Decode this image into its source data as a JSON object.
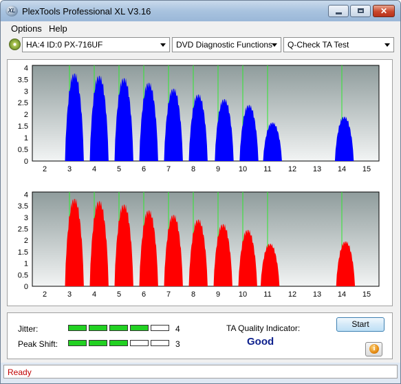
{
  "window": {
    "title": "PlexTools Professional XL V3.16",
    "icon_text": "XL"
  },
  "menu": {
    "options": "Options",
    "help": "Help"
  },
  "toolbar": {
    "drive": "HA:4 ID:0  PX-716UF",
    "function": "DVD Diagnostic Functions",
    "test": "Q-Check TA Test"
  },
  "colors": {
    "top_series": "#0000ff",
    "bottom_series": "#ff0000",
    "gridline": "#2ee82e",
    "plot_bg": "#9ea9a9"
  },
  "chart_data": [
    {
      "type": "area",
      "x_ticks": [
        "2",
        "3",
        "4",
        "5",
        "6",
        "7",
        "8",
        "9",
        "10",
        "11",
        "12",
        "13",
        "14",
        "15"
      ],
      "y_ticks": [
        "0",
        "0.5",
        "1",
        "1.5",
        "2",
        "2.5",
        "3",
        "3.5",
        "4"
      ],
      "xlim": [
        1.5,
        15.5
      ],
      "ylim": [
        0,
        4.1
      ],
      "grid": "vertical lines at 3, 4, 5, 6, 7, 8, 9, 10, 11, 14",
      "series": [
        {
          "peaks": [
            {
              "center": 3.2,
              "height": 3.75
            },
            {
              "center": 4.2,
              "height": 3.65
            },
            {
              "center": 5.2,
              "height": 3.55
            },
            {
              "center": 6.2,
              "height": 3.35
            },
            {
              "center": 7.2,
              "height": 3.1
            },
            {
              "center": 8.2,
              "height": 2.85
            },
            {
              "center": 9.25,
              "height": 2.65
            },
            {
              "center": 10.25,
              "height": 2.4
            },
            {
              "center": 11.2,
              "height": 1.65
            },
            {
              "center": 14.1,
              "height": 1.9
            }
          ]
        }
      ]
    },
    {
      "type": "area",
      "x_ticks": [
        "2",
        "3",
        "4",
        "5",
        "6",
        "7",
        "8",
        "9",
        "10",
        "11",
        "12",
        "13",
        "14",
        "15"
      ],
      "y_ticks": [
        "0",
        "0.5",
        "1",
        "1.5",
        "2",
        "2.5",
        "3",
        "3.5",
        "4"
      ],
      "xlim": [
        1.5,
        15.5
      ],
      "ylim": [
        0,
        4.1
      ],
      "grid": "vertical lines at 3, 4, 5, 6, 7, 8, 9, 10, 11, 14",
      "series": [
        {
          "peaks": [
            {
              "center": 3.2,
              "height": 3.8
            },
            {
              "center": 4.2,
              "height": 3.7
            },
            {
              "center": 5.2,
              "height": 3.55
            },
            {
              "center": 6.2,
              "height": 3.3
            },
            {
              "center": 7.2,
              "height": 3.1
            },
            {
              "center": 8.2,
              "height": 2.9
            },
            {
              "center": 9.2,
              "height": 2.7
            },
            {
              "center": 10.2,
              "height": 2.45
            },
            {
              "center": 11.1,
              "height": 1.85
            },
            {
              "center": 14.15,
              "height": 1.95
            }
          ]
        }
      ]
    }
  ],
  "metrics": {
    "jitter": {
      "label": "Jitter:",
      "value": "4",
      "filled": 4,
      "total": 5
    },
    "peak_shift": {
      "label": "Peak Shift:",
      "value": "3",
      "filled": 3,
      "total": 5
    }
  },
  "quality": {
    "label": "TA Quality Indicator:",
    "value": "Good"
  },
  "buttons": {
    "start": "Start",
    "info": "i"
  },
  "status": {
    "text": "Ready"
  }
}
